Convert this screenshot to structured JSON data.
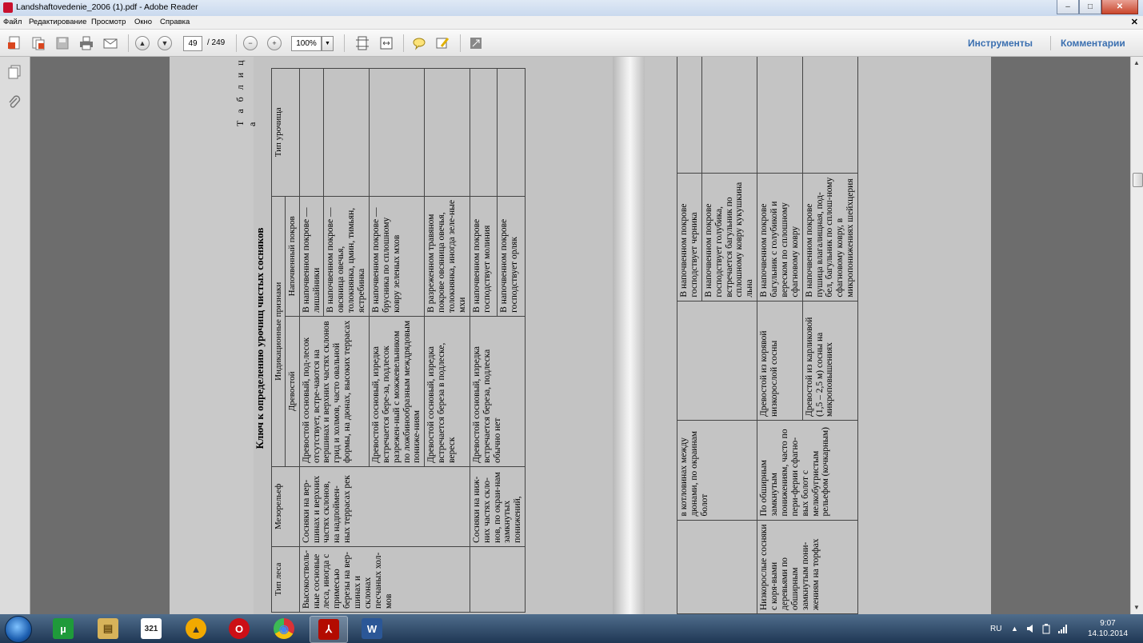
{
  "window": {
    "title": "Landshaftovedenie_2006 (1).pdf - Adobe Reader",
    "min_glyph": "–",
    "max_glyph": "□",
    "close_glyph": "✕"
  },
  "menu": [
    "Файл",
    "Редактирование",
    "Просмотр",
    "Окно",
    "Справка"
  ],
  "menu_close": "✕",
  "toolbar": {
    "page_current": "49",
    "page_total": "/ 249",
    "zoom": "100%",
    "zoom_dropdown": "▼",
    "tools_label": "Инструменты",
    "comments_label": "Комментарии"
  },
  "document": {
    "table_label": "Т а б л и ц а",
    "table_title": "Ключ к определению урочищ чистых сосняков",
    "headers": {
      "forest_type": "Тип леса",
      "mesorelief": "Мезорельеф",
      "indication": "Индикационные признаки",
      "tree_stand": "Древостой",
      "ground_cover": "Напочвенный покров",
      "tract_type": "Тип урочища"
    },
    "left_rows": [
      {
        "forest_type": "Высокостволь-ные сосновые леса, иногда с примесью березы на вер-шинах и склонах песчаных хол-мов",
        "mesorelief": "Сосняки на вер-шинах и верхних частях склонов, на надпоймен-ных террасах рек",
        "tree_stand": "Древостой сосновый, под-лесок отсутствует, встре-чаются на вершинах и верхних частях склонов грид и холмов, часто овальной формы, на дюнах, высоких террасах",
        "ground_cover": "В напочвенном покрове — лишайники"
      },
      {
        "forest_type": "",
        "mesorelief": "",
        "tree_stand": "",
        "ground_cover": "В напочвенном покрове — овсяница овечья, толокнянка, цмин, тимьян, ястребинка"
      },
      {
        "forest_type": "",
        "mesorelief": "",
        "tree_stand": "Древостой сосновый, изредка встречается бере-за, подлесок разрежен-ный с можжевельником по ложбинообразным междрядовым пониже-ниям",
        "ground_cover": "В напочвенном покрове — брусника по сплошному ковру зеленых мхов"
      },
      {
        "forest_type": "",
        "mesorelief": "",
        "tree_stand": "Древостой сосновый, изредка встречается береза в подлеске, вереск",
        "ground_cover": "В разреженном травяном покрове овсяница овечья, толокнянка, иногда зеле-ные мхи"
      },
      {
        "forest_type": "",
        "mesorelief": "Сосняки на ниж-них частях скло-нов, по окраи-нам замкнутых понижений,",
        "tree_stand": "Древостой сосновый, изредка встречается береза, подлеска обычно нет",
        "ground_cover": "В напочвенном покрове господствует молиния"
      },
      {
        "forest_type": "",
        "mesorelief": "",
        "tree_stand": "",
        "ground_cover": "В напочвенном покрове господствует орляк"
      }
    ],
    "right_rows": [
      {
        "forest_type": "",
        "mesorelief": "в котловинах между дюнами, по окраинам болот",
        "tree_stand": "",
        "ground_cover": "В напочвенном покрове господствует черника"
      },
      {
        "forest_type": "",
        "mesorelief": "",
        "tree_stand": "",
        "ground_cover": "В напочвенном покрове господствует голубика, встречается багульник по сплошному ковру кукушкина льна"
      },
      {
        "forest_type": "Низкорослые сосняки с коря-выми деревьями по обширным замкнутым пони-жениям на торфах",
        "mesorelief": "По обширным замкнутым понижениям, часто по пери-ферии сфагно-вых болот с мелкобугристым рельефом (кочкарным)",
        "tree_stand": "Древостой из корявой низкорослой сосны",
        "ground_cover": "В напочвенном покрове багульник с голубикой и вереском по сплошному сфагновому ковру"
      },
      {
        "forest_type": "",
        "mesorelief": "",
        "tree_stand": "Древостой из карликовой (1,5 – 2,5 м) сосны на микроповышениях",
        "ground_cover": "В напочвенном покрове пушица влагалищная, под-бел, багульник по сплош-ному сфагновому ковру, в микропонижениях шейхцерия"
      }
    ]
  },
  "taskbar": {
    "apps": [
      {
        "name": "utorrent",
        "color": "#1f9a3a",
        "glyph": "µ"
      },
      {
        "name": "explorer",
        "color": "#d7b35a",
        "glyph": "▤"
      },
      {
        "name": "calendar-321",
        "color": "#5b5b5b",
        "glyph": "321"
      },
      {
        "name": "avast",
        "color": "#f2a900",
        "glyph": "▲"
      },
      {
        "name": "opera",
        "color": "#cc0f16",
        "glyph": "O"
      },
      {
        "name": "chrome",
        "color": "#2f8f3b",
        "glyph": "◉"
      },
      {
        "name": "adobe-reader",
        "color": "#b30b00",
        "glyph": "⅄"
      },
      {
        "name": "word",
        "color": "#2b5797",
        "glyph": "W"
      }
    ],
    "lang": "RU",
    "time": "9:07",
    "date": "14.10.2014"
  }
}
